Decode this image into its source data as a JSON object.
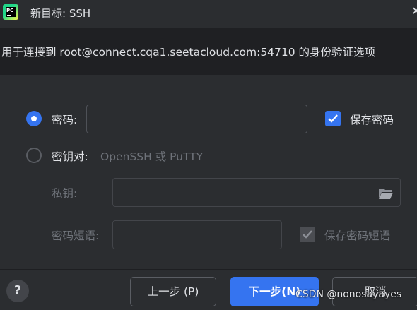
{
  "window": {
    "title": "新目标: SSH",
    "app_logo_text": "PC"
  },
  "header": {
    "description": "用于连接到 root@connect.cqa1.seetacloud.com:54710 的身份验证选项"
  },
  "auth": {
    "password_option": {
      "label": "密码:",
      "selected": true
    },
    "password_field": {
      "value": ""
    },
    "save_password": {
      "label": "保存密码",
      "checked": true
    },
    "keypair_option": {
      "label": "密钥对:",
      "hint": "OpenSSH 或 PuTTY",
      "selected": false
    },
    "private_key": {
      "label": "私钥:",
      "value": ""
    },
    "passphrase": {
      "label": "密码短语:",
      "value": ""
    },
    "save_passphrase": {
      "label": "保存密码短语",
      "checked": true,
      "disabled": true
    }
  },
  "footer": {
    "help_label": "?",
    "back_label": "上一步 (P)",
    "next_label": "下一步(N)",
    "cancel_label": "取消"
  },
  "watermark": "CSDN @nonosayayes",
  "colors": {
    "accent": "#3574f0",
    "background": "#2b2d30",
    "header_band": "#1f2023"
  }
}
